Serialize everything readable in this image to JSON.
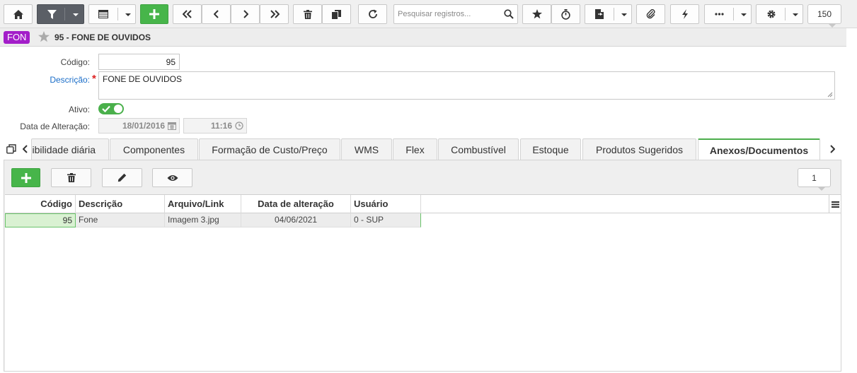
{
  "toolbar": {
    "search_placeholder": "Pesquisar registros...",
    "record_count": "150"
  },
  "header": {
    "badge": "FON",
    "title": "95 - FONE DE OUVIDOS"
  },
  "form": {
    "codigo_label": "Código:",
    "codigo_value": "95",
    "descricao_label": "Descrição:",
    "descricao_value": "FONE DE OUVIDOS",
    "ativo_label": "Ativo:",
    "ativo_on": true,
    "data_alteracao_label": "Data de Alteração:",
    "data_value": "18/01/2016",
    "hora_value": "11:16"
  },
  "tabs": [
    {
      "label": "ibilidade diária"
    },
    {
      "label": "Componentes"
    },
    {
      "label": "Formação de Custo/Preço"
    },
    {
      "label": "WMS"
    },
    {
      "label": "Flex"
    },
    {
      "label": "Combustível"
    },
    {
      "label": "Estoque"
    },
    {
      "label": "Produtos Sugeridos"
    },
    {
      "label": "Anexos/Documentos",
      "active": true
    }
  ],
  "attachments": {
    "count": "1",
    "columns": [
      "Código",
      "Descrição",
      "Arquivo/Link",
      "Data de alteração",
      "Usuário"
    ],
    "rows": [
      {
        "codigo": "95",
        "descricao": "Fone",
        "arquivo": "Imagem 3.jpg",
        "data": "04/06/2021",
        "usuario": "0 - SUP"
      }
    ]
  },
  "colors": {
    "accent_green": "#47b54a",
    "badge_purple": "#a31ec9",
    "link_blue": "#1a6dc8"
  }
}
